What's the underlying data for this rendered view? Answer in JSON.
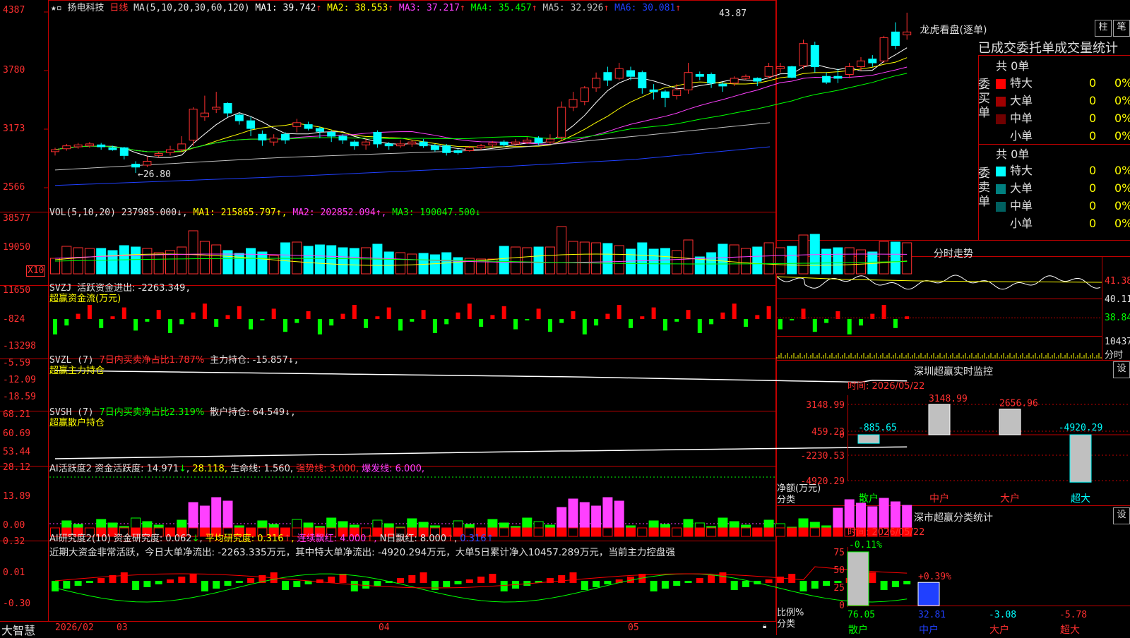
{
  "header": {
    "stock_name": "扬电科技",
    "period": "日线",
    "ma_label": "MA(5,10,20,30,60,120)",
    "ma": [
      {
        "name": "MA1:",
        "value": "39.742",
        "arrow": "↑",
        "color": "#ffffff"
      },
      {
        "name": "MA2:",
        "value": "38.553",
        "arrow": "↑",
        "color": "#ffff00"
      },
      {
        "name": "MA3:",
        "value": "37.217",
        "arrow": "↑",
        "color": "#ff40ff"
      },
      {
        "name": "MA4:",
        "value": "35.457",
        "arrow": "↑",
        "color": "#00ff00"
      },
      {
        "name": "MA5:",
        "value": "32.926",
        "arrow": "↑",
        "color": "#c0c0c0"
      },
      {
        "name": "MA6:",
        "value": "30.081",
        "arrow": "↑",
        "color": "#2040ff"
      }
    ],
    "high_marker": "43.87",
    "low_marker": "26.80",
    "price_axis": [
      "4387",
      "3780",
      "3173",
      "2566"
    ]
  },
  "vol": {
    "title": "VOL(5,10,20)",
    "value": "237985.000",
    "ma1": "MA1: 215865.797",
    "ma2": "MA2: 202852.094",
    "ma3": "MA3: 190047.500",
    "axis": [
      "38577",
      "19050"
    ],
    "unit": "X10"
  },
  "svzj": {
    "title": "SVZJ",
    "text1": "活跃资金进出: -2263.349",
    "text2": "超赢资金流(万元)",
    "axis": [
      "11650",
      "-824",
      "-13298"
    ]
  },
  "svzl": {
    "title": "SVZL (7)",
    "text1": "7日内买卖净占比1.787%",
    "text2": "主力持仓: -15.857",
    "text3": "超赢主力持仓",
    "axis": [
      "-5.59",
      "-12.09",
      "-18.59"
    ]
  },
  "svsh": {
    "title": "SVSH (7)",
    "text1": "7日内买卖净占比2.319%",
    "text2": "散户持仓: 64.549",
    "text3": "超赢散户持仓",
    "axis": [
      "68.21",
      "60.69",
      "53.44"
    ]
  },
  "ai1": {
    "title": "AI活跃度2",
    "t1": "资金活跃度: 14.971",
    "t2": "28.118",
    "t3": "生命线: 1.560",
    "t4": "强势线: 3.000",
    "t5": "爆发线: 6.000",
    "axis": [
      "28.12",
      "13.89",
      "0.00"
    ]
  },
  "ai2": {
    "title": "AI研究度2(10)",
    "t1": "资金研究度: 0.062",
    "t2": "平均研究度: 0.316",
    "t3": "连续飘红: 4.000",
    "t4": "N日飘红: 8.000",
    "t5": "0.316",
    "comment": "近期大资金非常活跃，今日大单净流出: -2263.335万元，其中特大单净流出: -4920.294万元，大单5日累计净入10457.289万元，当前主力控盘强",
    "axis": [
      "0.32",
      "0.01",
      "-0.30"
    ]
  },
  "footer": {
    "brand": "大智慧",
    "dates": [
      "2026/02",
      "03",
      "04",
      "05"
    ]
  },
  "right": {
    "lhb_title": "龙虎看盘(逐单)",
    "btn_zhu": "柱",
    "btn_bi": "笔",
    "tabs_header": "已成交委托单成交量统计",
    "buy_label": "委买单",
    "sell_label": "委卖单",
    "buy_total": "共 0单",
    "sell_total": "共 0单",
    "buy_rows": [
      {
        "name": "特大",
        "val": "0",
        "pct": "0%",
        "color": "#ff0000"
      },
      {
        "name": "大单",
        "val": "0",
        "pct": "0%",
        "color": "#a00000"
      },
      {
        "name": "中单",
        "val": "0",
        "pct": "0%",
        "color": "#700000"
      },
      {
        "name": "小单",
        "val": "0",
        "pct": "0%",
        "color": ""
      }
    ],
    "sell_rows": [
      {
        "name": "特大",
        "val": "0",
        "pct": "0%",
        "color": "#00ffff"
      },
      {
        "name": "大单",
        "val": "0",
        "pct": "0%",
        "color": "#008080"
      },
      {
        "name": "中单",
        "val": "0",
        "pct": "0%",
        "color": "#006060"
      },
      {
        "name": "小单",
        "val": "0",
        "pct": "0%",
        "color": ""
      }
    ],
    "intraday_title": "分时走势",
    "intraday_axis": [
      "41.38",
      "40.11",
      "38.84"
    ],
    "intraday_vol": "10437",
    "intraday_unit": "分时",
    "sz_title": "深圳超赢实时监控",
    "sz_setting": "设",
    "sz_time": "时间: 2026/05/22",
    "sz_axis": [
      "3148.99",
      "459.23",
      "0",
      "-2230.53",
      "-4920.29"
    ],
    "sz_ylabel": "净额(万元)",
    "sz_xlabel": "分类",
    "sz_cats": [
      "散户",
      "中户",
      "大户",
      "超大"
    ],
    "sz_values": [
      -885.65,
      3148.99,
      2656.96,
      -4920.29
    ],
    "sz_value_labels": [
      "-885.65",
      "3148.99",
      "2656.96",
      "-4920.29"
    ],
    "ss_title": "深市超赢分类统计",
    "ss_setting": "设",
    "ss_time": "时间: 2026/05/22",
    "ss_axis": [
      "75",
      "50",
      "25",
      "0"
    ],
    "ss_ylabel": "比例%",
    "ss_xlabel": "分类",
    "ss_cats": [
      "散户",
      "中户",
      "大户",
      "超大"
    ],
    "ss_values": [
      76.05,
      32.81,
      -3.08,
      -5.78
    ],
    "ss_value_labels": [
      "76.05",
      "32.81",
      "-3.08",
      "-5.78"
    ],
    "ss_top_labels": [
      "-0.11%",
      "+0.39%"
    ]
  },
  "chart_data": {
    "type": "candlestick",
    "price_range": [
      2566,
      4387
    ],
    "candles": [
      [
        2940,
        2960,
        2900,
        2980,
        "d"
      ],
      [
        2970,
        3000,
        2950,
        3020,
        "u"
      ],
      [
        2990,
        3010,
        2970,
        3030,
        "u"
      ],
      [
        3000,
        3020,
        2980,
        3040,
        "u"
      ],
      [
        3010,
        2990,
        2960,
        3030,
        "u"
      ],
      [
        2980,
        2960,
        2950,
        3000,
        "d"
      ],
      [
        2980,
        2900,
        2860,
        2990,
        "u"
      ],
      [
        2810,
        2780,
        2720,
        2840,
        "d"
      ],
      [
        2800,
        2840,
        2780,
        2890,
        "u"
      ],
      [
        2900,
        2920,
        2880,
        2940,
        "d"
      ],
      [
        2930,
        2960,
        2900,
        3000,
        "u"
      ],
      [
        2960,
        3020,
        2940,
        3100,
        "u"
      ],
      [
        3060,
        3380,
        3000,
        3400,
        "u"
      ],
      [
        3300,
        3340,
        3260,
        3520,
        "u"
      ],
      [
        3380,
        3400,
        3340,
        3560,
        "u"
      ],
      [
        3440,
        3340,
        3300,
        3450,
        "u"
      ],
      [
        3320,
        3260,
        3220,
        3340,
        "d"
      ],
      [
        3260,
        3180,
        3100,
        3300,
        "u"
      ],
      [
        3120,
        3060,
        3000,
        3160,
        "d"
      ],
      [
        3040,
        3080,
        3000,
        3120,
        "u"
      ],
      [
        3120,
        3060,
        3020,
        3140,
        "d"
      ],
      [
        3200,
        3240,
        3140,
        3280,
        "u"
      ],
      [
        3220,
        3180,
        3160,
        3250,
        "d"
      ],
      [
        3180,
        3150,
        3080,
        3200,
        "d"
      ],
      [
        3140,
        3100,
        3040,
        3160,
        "d"
      ],
      [
        3100,
        3060,
        3020,
        3120,
        "d"
      ],
      [
        3040,
        3000,
        2960,
        3060,
        "d"
      ],
      [
        3010,
        3040,
        2960,
        3080,
        "u"
      ],
      [
        3140,
        3020,
        2980,
        3160,
        "d"
      ],
      [
        3020,
        3000,
        2960,
        3040,
        "d"
      ],
      [
        3000,
        3020,
        2980,
        3060,
        "u"
      ],
      [
        3020,
        3040,
        2990,
        3060,
        "u"
      ],
      [
        3040,
        3000,
        2980,
        3070,
        "d"
      ],
      [
        3000,
        2960,
        2940,
        3020,
        "d"
      ],
      [
        3000,
        2930,
        2900,
        3020,
        "d"
      ],
      [
        2950,
        2930,
        2910,
        2970,
        "d"
      ],
      [
        2950,
        2980,
        2940,
        3000,
        "u"
      ],
      [
        2980,
        3000,
        2960,
        3020,
        "u"
      ],
      [
        3010,
        3030,
        2980,
        3050,
        "d"
      ],
      [
        3040,
        3010,
        2990,
        3060,
        "d"
      ],
      [
        3020,
        3040,
        3000,
        3070,
        "u"
      ],
      [
        3040,
        3060,
        3020,
        3090,
        "u"
      ],
      [
        3080,
        3030,
        3010,
        3100,
        "d"
      ],
      [
        3040,
        3070,
        3020,
        3120,
        "u"
      ],
      [
        3090,
        3400,
        3060,
        3460,
        "u"
      ],
      [
        3400,
        3480,
        3360,
        3560,
        "u"
      ],
      [
        3460,
        3600,
        3420,
        3620,
        "u"
      ],
      [
        3600,
        3700,
        3560,
        3760,
        "u"
      ],
      [
        3760,
        3680,
        3620,
        3820,
        "d"
      ],
      [
        3700,
        3800,
        3680,
        3860,
        "u"
      ],
      [
        3780,
        3720,
        3680,
        3820,
        "d"
      ],
      [
        3760,
        3600,
        3540,
        3780,
        "d"
      ],
      [
        3580,
        3560,
        3480,
        3640,
        "d"
      ],
      [
        3560,
        3500,
        3400,
        3580,
        "d"
      ],
      [
        3520,
        3580,
        3480,
        3640,
        "u"
      ],
      [
        3580,
        3760,
        3540,
        3860,
        "u"
      ],
      [
        3740,
        3720,
        3680,
        3770,
        "d"
      ],
      [
        3740,
        3650,
        3600,
        3760,
        "d"
      ],
      [
        3640,
        3620,
        3560,
        3660,
        "d"
      ],
      [
        3650,
        3700,
        3620,
        3720,
        "u"
      ],
      [
        3700,
        3720,
        3680,
        3740,
        "u"
      ],
      [
        3700,
        3670,
        3620,
        3710,
        "d"
      ],
      [
        3720,
        3820,
        3700,
        3860,
        "u"
      ],
      [
        3800,
        3820,
        3760,
        3860,
        "u"
      ],
      [
        3820,
        3710,
        3700,
        3830,
        "d"
      ],
      [
        3830,
        4060,
        3800,
        4100,
        "u"
      ],
      [
        4040,
        3820,
        3760,
        4080,
        "u"
      ],
      [
        3720,
        3660,
        3640,
        3760,
        "d"
      ],
      [
        3720,
        3700,
        3650,
        3800,
        "d"
      ],
      [
        3740,
        3820,
        3700,
        3860,
        "u"
      ],
      [
        3820,
        3880,
        3780,
        3920,
        "u"
      ],
      [
        3900,
        3860,
        3820,
        3940,
        "d"
      ],
      [
        3880,
        4120,
        3860,
        4140,
        "u"
      ],
      [
        4180,
        4040,
        4000,
        4280,
        "d"
      ],
      [
        4150,
        4180,
        4100,
        4380,
        "d"
      ]
    ]
  }
}
